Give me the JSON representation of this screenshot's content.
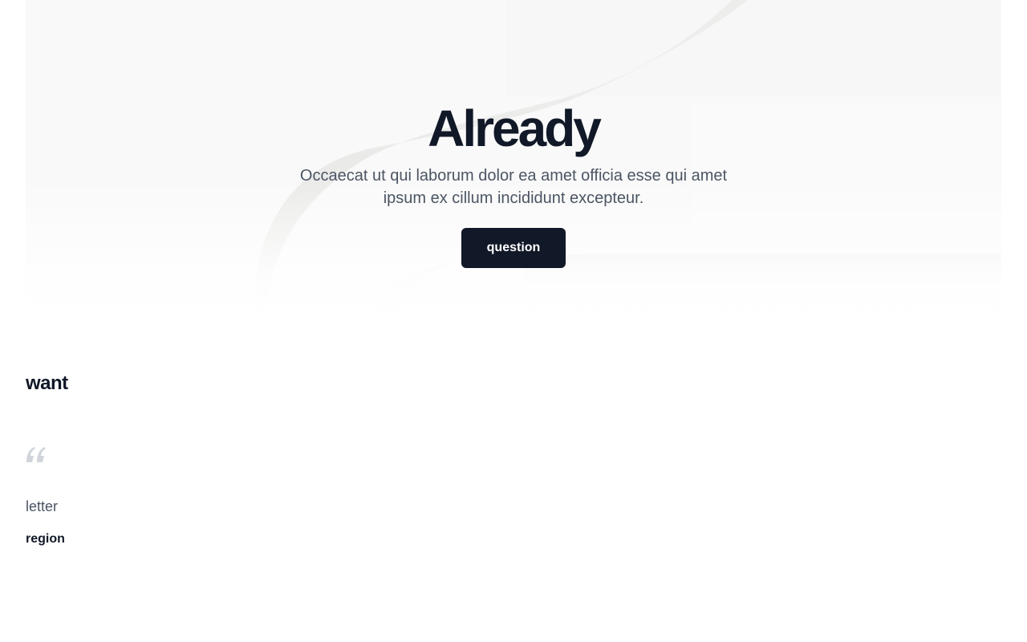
{
  "hero": {
    "title": "Already",
    "subtitle": "Occaecat ut qui laborum dolor ea amet officia esse qui amet ipsum ex cillum incididunt excepteur.",
    "button_label": "question"
  },
  "testimonial": {
    "section_title": "want",
    "quote_icon": "quote-icon",
    "quote": "letter",
    "author": "region"
  },
  "colors": {
    "primary": "#111827",
    "muted_text": "#4b5563",
    "hero_bg": "#f9f9f9",
    "quote_icon": "#d1d5db"
  }
}
